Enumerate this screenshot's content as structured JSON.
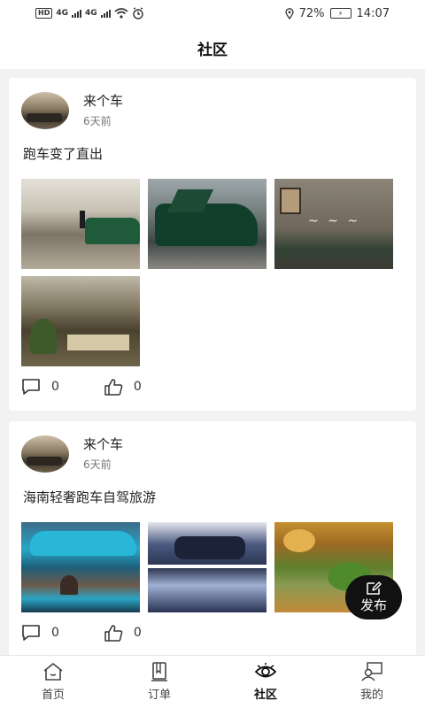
{
  "status_bar": {
    "network_badge": "HD",
    "signal1_label": "4G",
    "signal2_label": "4G",
    "battery_percent": "72%",
    "time": "14:07"
  },
  "header": {
    "title": "社区"
  },
  "posts": [
    {
      "user_name": "来个车",
      "time_ago": "6天前",
      "text": "跑车变了直出",
      "comment_count": "0",
      "like_count": "0",
      "image_count": 4
    },
    {
      "user_name": "来个车",
      "time_ago": "6天前",
      "text": "海南轻奢跑车自驾旅游",
      "comment_count": "0",
      "like_count": "0",
      "image_count": 3
    }
  ],
  "fab": {
    "label": "发布",
    "icon": "edit-icon"
  },
  "tabbar": {
    "tabs": [
      {
        "label": "首页",
        "icon": "home-icon",
        "active": false
      },
      {
        "label": "订单",
        "icon": "order-book-icon",
        "active": false
      },
      {
        "label": "社区",
        "icon": "eye-icon",
        "active": true
      },
      {
        "label": "我的",
        "icon": "profile-icon",
        "active": false
      }
    ]
  },
  "colors": {
    "fab_bg": "#111111",
    "page_bg": "#f2f2f2",
    "card_bg": "#ffffff"
  }
}
